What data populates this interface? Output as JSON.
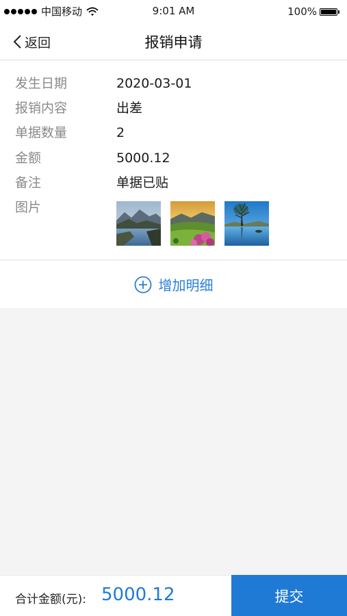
{
  "status_bar": {
    "carrier": "中国移动",
    "time": "9:01 AM",
    "battery": "100%"
  },
  "nav": {
    "back_label": "返回",
    "title": "报销申请"
  },
  "details": [
    {
      "label": "发生日期",
      "value": "2020-03-01"
    },
    {
      "label": "报销内容",
      "value": "出差"
    },
    {
      "label": "单据数量",
      "value": "2"
    },
    {
      "label": "金额",
      "value": "5000.12"
    },
    {
      "label": "备注",
      "value": "单据已贴"
    }
  ],
  "images": {
    "label": "图片",
    "items": [
      "lake-mountain-photo",
      "flower-hill-photo",
      "tree-lake-photo"
    ]
  },
  "add_detail_label": "增加明细",
  "footer": {
    "total_label": "合计金额(元):",
    "total_value": "5000.12",
    "submit_label": "提交"
  },
  "colors": {
    "accent": "#1f7ad6",
    "label_gray": "#8a8a8a",
    "background": "#f4f4f4"
  }
}
